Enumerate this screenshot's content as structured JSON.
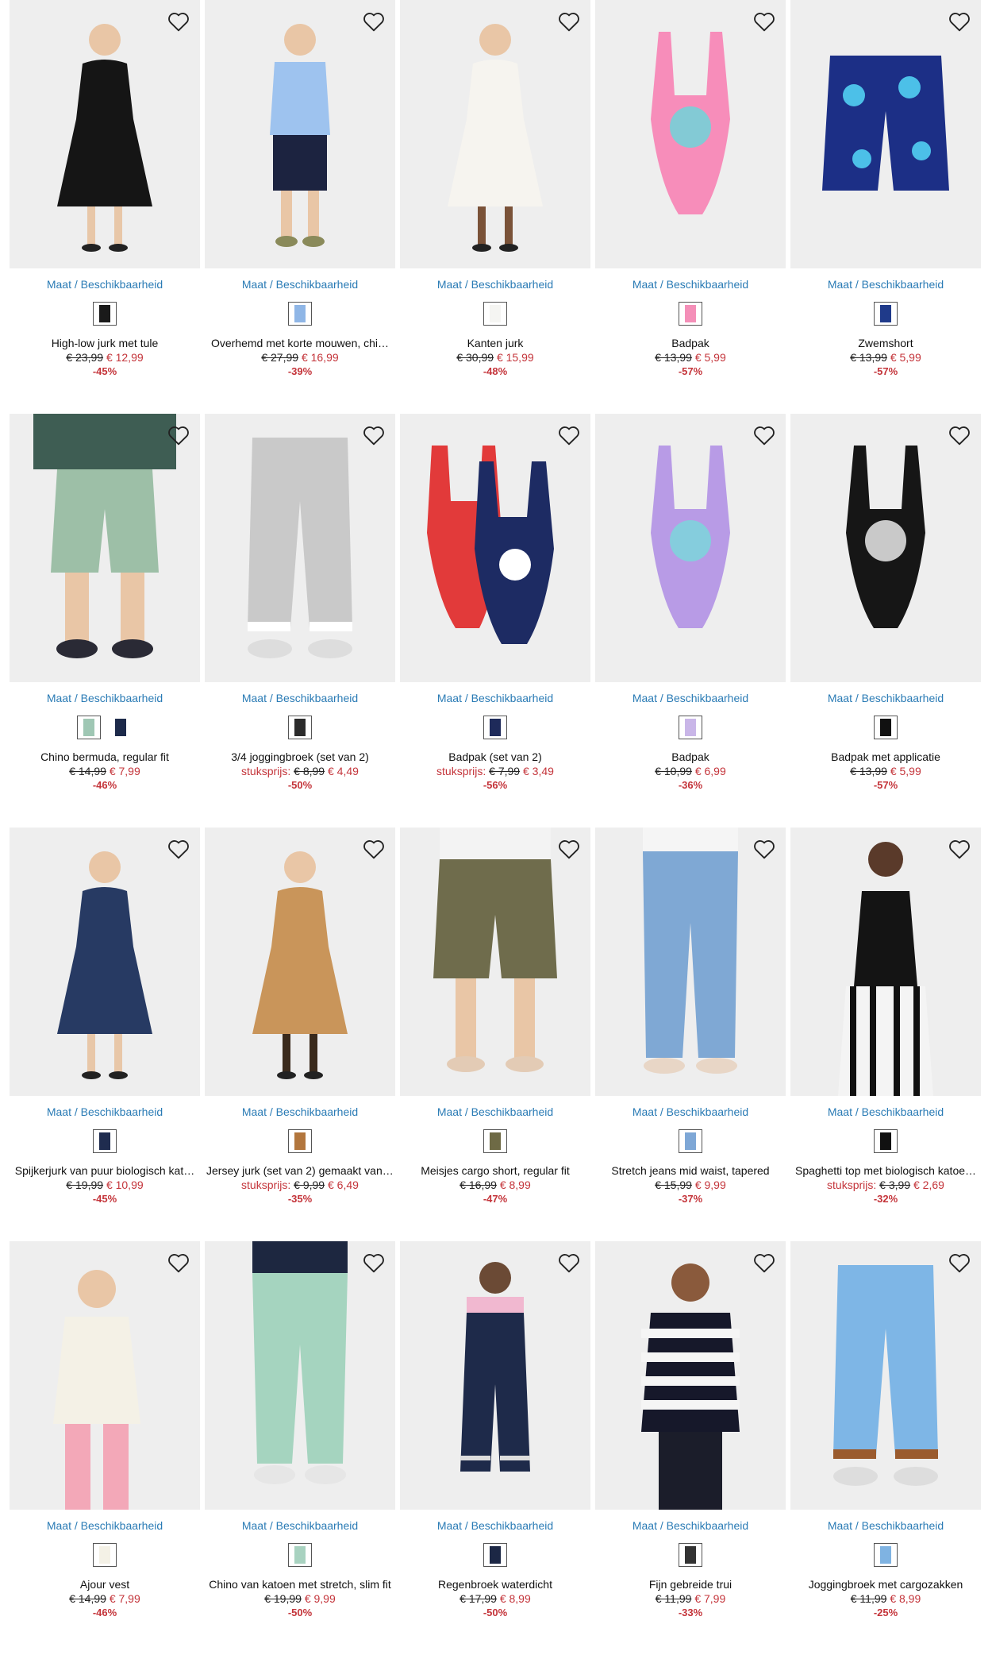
{
  "ui": {
    "availability_label": "Maat / Beschikbaarheid"
  },
  "colors": {
    "link": "#2a7bb5",
    "sale": "#c4343a",
    "image_bg": "#eeeeee"
  },
  "products": [
    {
      "name": "High-low jurk met tule",
      "price_prefix": "",
      "old_price": "€ 23,99",
      "new_price": "€ 12,99",
      "discount": "-45%",
      "swatches": [
        "#1a1a1a"
      ],
      "image": {
        "type": "dress",
        "main": "#151515",
        "accent": "#e8c7a8"
      }
    },
    {
      "name": "Overhemd met korte mouwen, chi…",
      "price_prefix": "",
      "old_price": "€ 27,99",
      "new_price": "€ 16,99",
      "discount": "-39%",
      "swatches": [
        "#8fb6e6"
      ],
      "image": {
        "type": "outfit",
        "main": "#9ec3ef",
        "accent": "#1c2340"
      }
    },
    {
      "name": "Kanten jurk",
      "price_prefix": "",
      "old_price": "€ 30,99",
      "new_price": "€ 15,99",
      "discount": "-48%",
      "swatches": [
        "#f5f5f2"
      ],
      "image": {
        "type": "dress",
        "main": "#f6f4ef",
        "accent": "#7a5238"
      }
    },
    {
      "name": "Badpak",
      "price_prefix": "",
      "old_price": "€ 13,99",
      "new_price": "€ 5,99",
      "discount": "-57%",
      "swatches": [
        "#f48fb8"
      ],
      "image": {
        "type": "swimsuit",
        "main": "#f78dba",
        "accent": "#76d0d8"
      }
    },
    {
      "name": "Zwemshort",
      "price_prefix": "",
      "old_price": "€ 13,99",
      "new_price": "€ 5,99",
      "discount": "-57%",
      "swatches": [
        "#1f3a8a"
      ],
      "image": {
        "type": "shorts",
        "main": "#1c2f86",
        "accent": "#4cc0e8"
      }
    },
    {
      "name": "Chino bermuda, regular fit",
      "price_prefix": "",
      "old_price": "€ 14,99",
      "new_price": "€ 7,99",
      "discount": "-46%",
      "swatches": [
        "#9fc7b4",
        "#1d2a4a"
      ],
      "image": {
        "type": "bermuda",
        "main": "#9dbfa7",
        "accent": "#3e5d53"
      }
    },
    {
      "name": "3/4 joggingbroek (set van 2)",
      "price_prefix": "stuksprijs:",
      "old_price": "€ 8,99",
      "new_price": "€ 4,49",
      "discount": "-50%",
      "swatches": [
        "#2b2b2b"
      ],
      "image": {
        "type": "jogger",
        "main": "#c9c9c9",
        "accent": "#ffffff"
      }
    },
    {
      "name": "Badpak (set van 2)",
      "price_prefix": "stuksprijs:",
      "old_price": "€ 7,99",
      "new_price": "€ 3,49",
      "discount": "-56%",
      "swatches": [
        "#1e2a5a"
      ],
      "image": {
        "type": "swimset",
        "main": "#1d2b63",
        "accent": "#e23a3a"
      }
    },
    {
      "name": "Badpak",
      "price_prefix": "",
      "old_price": "€ 10,99",
      "new_price": "€ 6,99",
      "discount": "-36%",
      "swatches": [
        "#c9b6e8"
      ],
      "image": {
        "type": "swimsuit",
        "main": "#b89be6",
        "accent": "#7fd3dc"
      }
    },
    {
      "name": "Badpak met applicatie",
      "price_prefix": "",
      "old_price": "€ 13,99",
      "new_price": "€ 5,99",
      "discount": "-57%",
      "swatches": [
        "#111111"
      ],
      "image": {
        "type": "swimsuit",
        "main": "#161616",
        "accent": "#dddddd"
      }
    },
    {
      "name": "Spijkerjurk van puur biologisch kat…",
      "price_prefix": "",
      "old_price": "€ 19,99",
      "new_price": "€ 10,99",
      "discount": "-45%",
      "swatches": [
        "#1f2c4f"
      ],
      "image": {
        "type": "dress",
        "main": "#273a63",
        "accent": "#e8c7a8"
      }
    },
    {
      "name": "Jersey jurk (set van 2) gemaakt van …",
      "price_prefix": "stuksprijs:",
      "old_price": "€ 9,99",
      "new_price": "€ 6,49",
      "discount": "-35%",
      "swatches": [
        "#b2763d"
      ],
      "image": {
        "type": "dress",
        "main": "#c9955a",
        "accent": "#3a2a1c"
      }
    },
    {
      "name": "Meisjes cargo short, regular fit",
      "price_prefix": "",
      "old_price": "€ 16,99",
      "new_price": "€ 8,99",
      "discount": "-47%",
      "swatches": [
        "#6e6a45"
      ],
      "image": {
        "type": "cargo",
        "main": "#6f6c4c",
        "accent": "#f3f3f3"
      }
    },
    {
      "name": "Stretch jeans mid waist, tapered",
      "price_prefix": "",
      "old_price": "€ 15,99",
      "new_price": "€ 9,99",
      "discount": "-37%",
      "swatches": [
        "#7ea7d6"
      ],
      "image": {
        "type": "jeans",
        "main": "#7fa8d4",
        "accent": "#f5f5f5"
      }
    },
    {
      "name": "Spaghetti top met biologisch katoe…",
      "price_prefix": "stuksprijs:",
      "old_price": "€ 3,99",
      "new_price": "€ 2,69",
      "discount": "-32%",
      "swatches": [
        "#111111"
      ],
      "image": {
        "type": "top",
        "main": "#141414",
        "accent": "#5a3a2a"
      }
    },
    {
      "name": "Ajour vest",
      "price_prefix": "",
      "old_price": "€ 14,99",
      "new_price": "€ 7,99",
      "discount": "-46%",
      "swatches": [
        "#f4f1e6"
      ],
      "image": {
        "type": "cardigan",
        "main": "#f4f1e6",
        "accent": "#f3a8b8"
      }
    },
    {
      "name": "Chino van katoen met stretch, slim fit",
      "price_prefix": "",
      "old_price": "€ 19,99",
      "new_price": "€ 9,99",
      "discount": "-50%",
      "swatches": [
        "#a8d2c0"
      ],
      "image": {
        "type": "chino",
        "main": "#a5d4bf",
        "accent": "#1d2740"
      }
    },
    {
      "name": "Regenbroek waterdicht",
      "price_prefix": "",
      "old_price": "€ 17,99",
      "new_price": "€ 8,99",
      "discount": "-50%",
      "swatches": [
        "#1c2745"
      ],
      "image": {
        "type": "rainpants",
        "main": "#1e2a4a",
        "accent": "#f1b8d0"
      }
    },
    {
      "name": "Fijn gebreide trui",
      "price_prefix": "",
      "old_price": "€ 11,99",
      "new_price": "€ 7,99",
      "discount": "-33%",
      "swatches": [
        "#333333"
      ],
      "image": {
        "type": "sweater",
        "main": "#16182a",
        "accent": "#f5f5f5"
      }
    },
    {
      "name": "Joggingbroek met cargozakken",
      "price_prefix": "",
      "old_price": "€ 11,99",
      "new_price": "€ 8,99",
      "discount": "-25%",
      "swatches": [
        "#7fb3e2"
      ],
      "image": {
        "type": "jogger",
        "main": "#7eb6e6",
        "accent": "#9a5b2e"
      }
    }
  ]
}
